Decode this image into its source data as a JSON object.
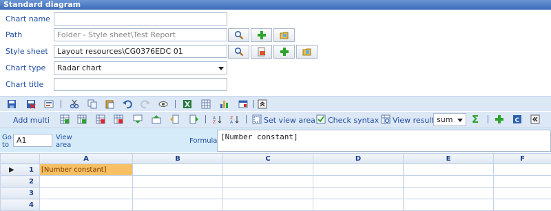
{
  "window": {
    "title": "Standard diagram"
  },
  "form": {
    "chart_name": {
      "label": "Chart name",
      "value": ""
    },
    "path": {
      "label": "Path",
      "placeholder": "Folder - Style sheet\\Test Report"
    },
    "style_sheet": {
      "label": "Style sheet",
      "value": "Layout resources\\CG0376EDC 01"
    },
    "chart_type": {
      "label": "Chart type",
      "value": "Radar chart"
    },
    "chart_title": {
      "label": "Chart title",
      "value": ""
    }
  },
  "toolbar2": {
    "add_multi": "Add multi",
    "set_view_area": "Set view area",
    "check_syntax": "Check syntax",
    "view_result": "View result",
    "aggregate": "sum"
  },
  "formula_bar": {
    "goto_label": "Go to",
    "cell_ref": "A1",
    "view_area_label": "View area",
    "formula_label": "Formula",
    "formula_value": "[Number constant]"
  },
  "grid": {
    "columns": [
      "A",
      "B",
      "C",
      "D",
      "E",
      "F"
    ],
    "rows": [
      {
        "num": "1",
        "cells": [
          "[Number constant]",
          "",
          "",
          "",
          "",
          ""
        ]
      },
      {
        "num": "2",
        "cells": [
          "",
          "",
          "",
          "",
          "",
          ""
        ]
      },
      {
        "num": "3",
        "cells": [
          "",
          "",
          "",
          "",
          "",
          ""
        ]
      },
      {
        "num": "4",
        "cells": [
          "",
          "",
          "",
          "",
          "",
          ""
        ]
      }
    ]
  },
  "colors": {
    "title_bar": "#3c6cb8",
    "toolbar_bg": "#dde8f6",
    "formula_bg": "#d6ebfa",
    "selected_cell": "#f7c064"
  }
}
